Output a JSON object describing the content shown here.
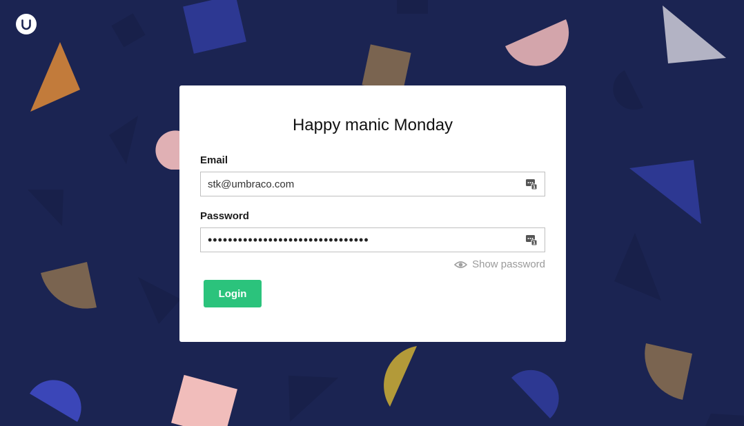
{
  "theme": {
    "background": "#1b2452",
    "card_background": "#ffffff",
    "accent": "#2bc37c"
  },
  "brand": {
    "logo_icon": "umbraco-logo-icon"
  },
  "login": {
    "greeting": "Happy manic Monday",
    "email_label": "Email",
    "email_value": "stk@umbraco.com",
    "password_label": "Password",
    "password_value": "••••••••••••••••••••••••••••••••",
    "password_manager_icon": "password-manager-icon",
    "show_password_icon": "eye-icon",
    "show_password_label": "Show password",
    "login_button_label": "Login"
  }
}
